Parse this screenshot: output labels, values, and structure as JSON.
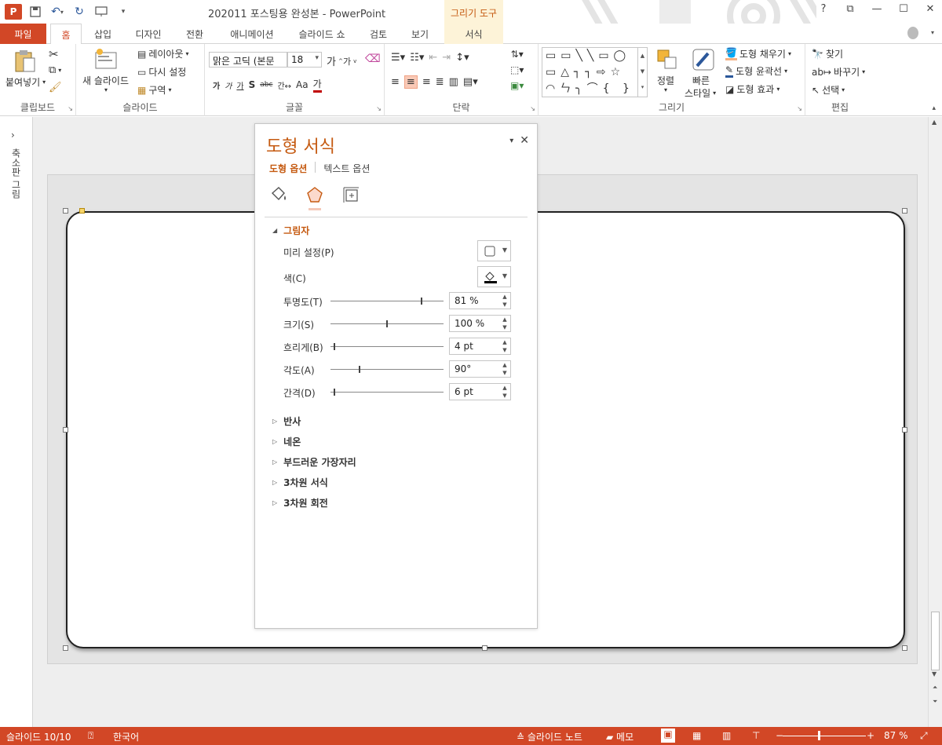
{
  "window": {
    "title": "202011 포스팅용 완성본 - PowerPoint",
    "context_tab_group": "그리기 도구",
    "controls": [
      "?",
      "⧉",
      "—",
      "☐",
      "✕"
    ]
  },
  "tabs": {
    "file": "파일",
    "home": "홈",
    "insert": "삽입",
    "design": "디자인",
    "transitions": "전환",
    "animations": "애니메이션",
    "slideshow": "슬라이드 쇼",
    "review": "검토",
    "view": "보기",
    "format": "서식"
  },
  "ribbon": {
    "clipboard": {
      "paste": "붙여넣기",
      "label": "클립보드"
    },
    "slides": {
      "new_slide": "새 슬라이드",
      "layout": "레이아웃",
      "reset": "다시 설정",
      "section": "구역",
      "label": "슬라이드"
    },
    "font": {
      "font_name": "맑은 고딕 (본문",
      "font_size": "18",
      "grow": "가",
      "shrink": "가",
      "bold": "가",
      "italic": "가",
      "underline": "가",
      "shadow": "S",
      "strike": "abc",
      "spacing": "간↔",
      "case": "Aa",
      "color": "가",
      "label": "글꼴"
    },
    "paragraph": {
      "label": "단락"
    },
    "drawing": {
      "arrange": "정렬",
      "quick_styles_1": "빠른",
      "quick_styles_2": "스타일",
      "fill": "도형 채우기",
      "outline": "도형 윤곽선",
      "effects": "도형 효과",
      "label": "그리기"
    },
    "editing": {
      "find": "찾기",
      "replace": "바꾸기",
      "select": "선택",
      "label": "편집"
    }
  },
  "thumbnail_pane": {
    "label": "축소판 그림",
    "arrow": "›"
  },
  "format_pane": {
    "title": "도형 서식",
    "tab_shape": "도형 옵션",
    "tab_text": "텍스트 옵션",
    "shadow_section": "그림자",
    "preset_label": "미리 설정(P)",
    "color_label": "색(C)",
    "transparency": {
      "label": "투명도(T)",
      "value": "81 %",
      "level": 0.81
    },
    "size": {
      "label": "크기(S)",
      "value": "100 %",
      "level": 0.5
    },
    "blur": {
      "label": "흐리게(B)",
      "value": "4 pt",
      "level": 0.03
    },
    "angle": {
      "label": "각도(A)",
      "value": "90°",
      "level": 0.25
    },
    "distance": {
      "label": "간격(D)",
      "value": "6 pt",
      "level": 0.03
    },
    "collapsed_sections": [
      "반사",
      "네온",
      "부드러운 가장자리",
      "3차원 서식",
      "3차원 회전"
    ]
  },
  "statusbar": {
    "slide": "슬라이드 10/10",
    "language": "한국어",
    "notes": "슬라이드 노트",
    "comments": "메모",
    "zoom": "87 %",
    "zoom_minus": "−",
    "zoom_plus": "+"
  },
  "colors": {
    "accent": "#d24726",
    "pane_title": "#c55a11",
    "context_tab": "#fdf3d8"
  }
}
